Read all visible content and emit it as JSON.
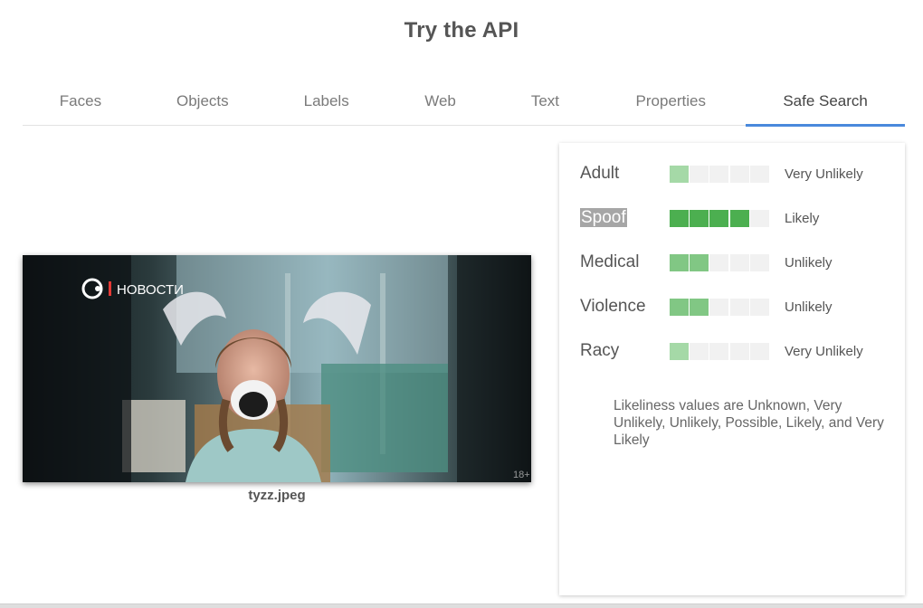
{
  "page": {
    "title": "Try the API"
  },
  "tabs": [
    {
      "label": "Faces"
    },
    {
      "label": "Objects"
    },
    {
      "label": "Labels"
    },
    {
      "label": "Web"
    },
    {
      "label": "Text"
    },
    {
      "label": "Properties"
    },
    {
      "label": "Safe Search",
      "active": true
    }
  ],
  "image": {
    "filename": "tyzz.jpeg",
    "logo_text": "НОВОСТИ",
    "age_badge": "18+"
  },
  "safe_search": {
    "rows": [
      {
        "category": "Adult",
        "likelihood": "Very Unlikely",
        "level": 1,
        "color": "#a5d9a7"
      },
      {
        "category": "Spoof",
        "likelihood": "Likely",
        "level": 4,
        "color": "#4caf50",
        "highlighted": true
      },
      {
        "category": "Medical",
        "likelihood": "Unlikely",
        "level": 2,
        "color": "#81c784"
      },
      {
        "category": "Violence",
        "likelihood": "Unlikely",
        "level": 2,
        "color": "#81c784"
      },
      {
        "category": "Racy",
        "likelihood": "Very Unlikely",
        "level": 1,
        "color": "#a5d9a7"
      }
    ],
    "segments": 5,
    "note": "Likeliness values are Unknown, Very Unlikely, Unlikely, Possible, Likely, and Very Likely"
  },
  "colors": {
    "accent": "#4a89dc",
    "empty_segment": "#f1f1f1"
  }
}
